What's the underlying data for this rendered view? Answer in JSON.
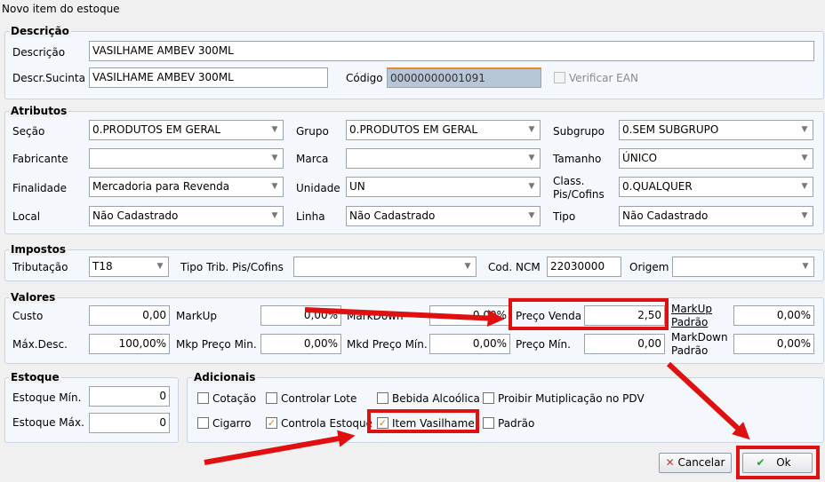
{
  "window": {
    "title": "Novo item do estoque"
  },
  "descricao": {
    "legend": "Descrição",
    "descricao_label": "Descrição",
    "descricao_value": "VASILHAME AMBEV 300ML",
    "sucinta_label": "Descr.Sucinta",
    "sucinta_value": "VASILHAME AMBEV 300ML",
    "codigo_label": "Código",
    "codigo_value": "00000000001091",
    "verificar_ean_label": "Verificar EAN"
  },
  "atributos": {
    "legend": "Atributos",
    "secao_label": "Seção",
    "secao_value": "0.PRODUTOS EM GERAL",
    "grupo_label": "Grupo",
    "grupo_value": "0.PRODUTOS EM GERAL",
    "subgrupo_label": "Subgrupo",
    "subgrupo_value": "0.SEM SUBGRUPO",
    "fabricante_label": "Fabricante",
    "fabricante_value": "",
    "marca_label": "Marca",
    "marca_value": "",
    "tamanho_label": "Tamanho",
    "tamanho_value": "ÚNICO",
    "finalidade_label": "Finalidade",
    "finalidade_value": "Mercadoria para Revenda",
    "unidade_label": "Unidade",
    "unidade_value": "UN",
    "class_label_1": "Class.",
    "class_label_2": "Pis/Cofins",
    "class_value": "0.QUALQUER",
    "local_label": "Local",
    "local_value": "Não Cadastrado",
    "linha_label": "Linha",
    "linha_value": "Não Cadastrado",
    "tipo_label": "Tipo",
    "tipo_value": "Não Cadastrado"
  },
  "impostos": {
    "legend": "Impostos",
    "tributacao_label": "Tributação",
    "tributacao_value": "T18",
    "tipo_trib_label": "Tipo Trib. Pis/Cofins",
    "tipo_trib_value": "",
    "ncm_label": "Cod. NCM",
    "ncm_value": "22030000",
    "origem_label": "Origem",
    "origem_value": ""
  },
  "valores": {
    "legend": "Valores",
    "custo_label": "Custo",
    "custo_value": "0,00",
    "markup_label": "MarkUp",
    "markup_value": "0,00%",
    "markdown_label": "MarkDown",
    "markdown_value": "0,00%",
    "preco_venda_label": "Preço Venda",
    "preco_venda_value": "2,50",
    "markup_padrao_label_1": "MarkUp",
    "markup_padrao_label_2": "Padrão",
    "markup_padrao_value": "0,00%",
    "max_desc_label": "Máx.Desc.",
    "max_desc_value": "100,00%",
    "mkp_preco_min_label": "Mkp Preço Min.",
    "mkp_preco_min_value": "0,00%",
    "mkd_preco_min_label": "Mkd Preço Mín.",
    "mkd_preco_min_value": "0,00%",
    "preco_min_label": "Preço Mín.",
    "preco_min_value": "0,00",
    "markdown_padrao_label_1": "MarkDown",
    "markdown_padrao_label_2": "Padrão",
    "markdown_padrao_value": "0,00%"
  },
  "estoque": {
    "legend": "Estoque",
    "min_label": "Estoque Mín.",
    "min_value": "0",
    "max_label": "Estoque Máx.",
    "max_value": "0"
  },
  "adicionais": {
    "legend": "Adicionais",
    "cotacao": {
      "label": "Cotação",
      "checked": false
    },
    "controlar_lote": {
      "label": "Controlar Lote",
      "checked": false
    },
    "bebida_alcoolica": {
      "label": "Bebida Alcoólica",
      "checked": false
    },
    "proibir_multiplicacao": {
      "label": "Proibir Mutiplicação no PDV",
      "checked": false
    },
    "cigarro": {
      "label": "Cigarro",
      "checked": false
    },
    "controla_estoque": {
      "label": "Controla Estoque",
      "checked": true
    },
    "item_vasilhame": {
      "label": "Item Vasilhame",
      "checked": true
    },
    "padrao": {
      "label": "Padrão",
      "checked": false
    }
  },
  "buttons": {
    "cancelar": "Cancelar",
    "ok": "Ok"
  },
  "icons": {
    "check_glyph": "✓",
    "cancel_glyph": "✕",
    "ok_glyph": "✔",
    "dropdown_glyph": "▼"
  },
  "colors": {
    "highlight": "#e01010",
    "checkbox_check": "#e07a1f",
    "ok_icon": "#2e9e2e",
    "cancel_icon": "#c0392b"
  }
}
